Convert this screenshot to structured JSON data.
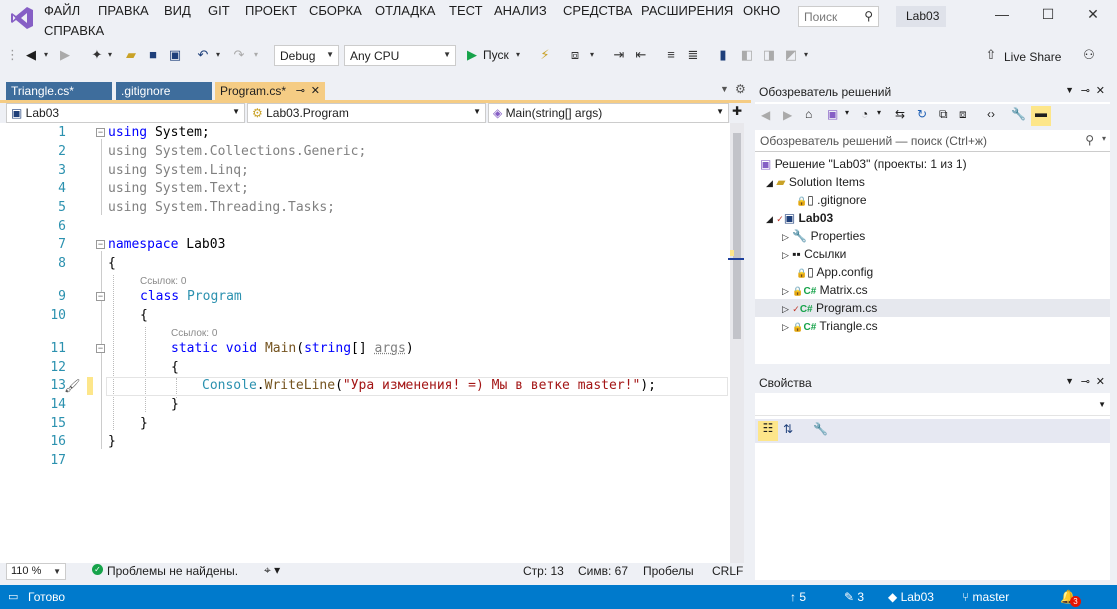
{
  "menu": {
    "items": [
      "ФАЙЛ",
      "ПРАВКА",
      "ВИД",
      "GIT",
      "ПРОЕКТ",
      "СБОРКА",
      "ОТЛАДКА",
      "ТЕСТ",
      "АНАЛИЗ",
      "СРЕДСТВА",
      "РАСШИРЕНИЯ",
      "ОКНО"
    ],
    "second_row": "СПРАВКА",
    "search_placeholder": "Поиск",
    "project_name": "Lab03"
  },
  "toolbar": {
    "config": "Debug",
    "platform": "Any CPU",
    "run_label": "Пуск",
    "live_share": "Live Share"
  },
  "tabs": [
    {
      "label": "Triangle.cs*",
      "active": false
    },
    {
      "label": ".gitignore",
      "active": false
    },
    {
      "label": "Program.cs*",
      "active": true
    }
  ],
  "nav": {
    "project": "Lab03",
    "class": "Lab03.Program",
    "member": "Main(string[] args)"
  },
  "code": {
    "line_numbers": [
      "1",
      "2",
      "3",
      "4",
      "5",
      "6",
      "7",
      "8",
      "9",
      "10",
      "11",
      "12",
      "13",
      "14",
      "15",
      "16",
      "17"
    ],
    "ref_label_1": "Ссылок: 0",
    "ref_label_2": "Ссылок: 0",
    "l1_kw": "using",
    "l1_rest": " System;",
    "l2": "using System.Collections.Generic;",
    "l3": "using System.Linq;",
    "l4": "using System.Text;",
    "l5": "using System.Threading.Tasks;",
    "l7_kw": "namespace",
    "l7_rest": " Lab03",
    "l8": "{",
    "l9_kw": "class",
    "l9_name": "Program",
    "l10": "{",
    "l11_kw1": "static",
    "l11_kw2": "void",
    "l11_fn": "Main",
    "l11_p1": "(",
    "l11_kw3": "string",
    "l11_p2": "[] ",
    "l11_arg": "args",
    "l11_p3": ")",
    "l12": "{",
    "l13_ty": "Console",
    "l13_dot": ".",
    "l13_fn": "WriteLine",
    "l13_p1": "(",
    "l13_str": "\"Ура изменения! =) Мы в ветке master!\"",
    "l13_p2": ");",
    "l14": "}",
    "l15": "}",
    "l16": "}"
  },
  "editor_status": {
    "zoom": "110 %",
    "problems": "Проблемы не найдены.",
    "line": "Стр: 13",
    "col": "Симв: 67",
    "spaces": "Пробелы",
    "eol": "CRLF"
  },
  "solution": {
    "title": "Обозреватель решений",
    "search_placeholder": "Обозреватель решений — поиск (Ctrl+ж)",
    "items": [
      {
        "label": "Решение \"Lab03\" (проекты: 1 из 1)"
      },
      {
        "label": "Solution Items"
      },
      {
        "label": ".gitignore"
      },
      {
        "label": "Lab03"
      },
      {
        "label": "Properties"
      },
      {
        "label": "Ссылки"
      },
      {
        "label": "App.config"
      },
      {
        "label": "Matrix.cs"
      },
      {
        "label": "Program.cs"
      },
      {
        "label": "Triangle.cs"
      }
    ]
  },
  "properties": {
    "title": "Свойства"
  },
  "statusbar": {
    "ready": "Готово",
    "up_count": "5",
    "pencil_count": "3",
    "repo": "Lab03",
    "branch": "master",
    "notifications": "3"
  },
  "colors": {
    "accent": "#007acc",
    "active_tab": "#f5cc84",
    "inactive_tab": "#3e6d9c",
    "vs_purple": "#865fc5"
  }
}
